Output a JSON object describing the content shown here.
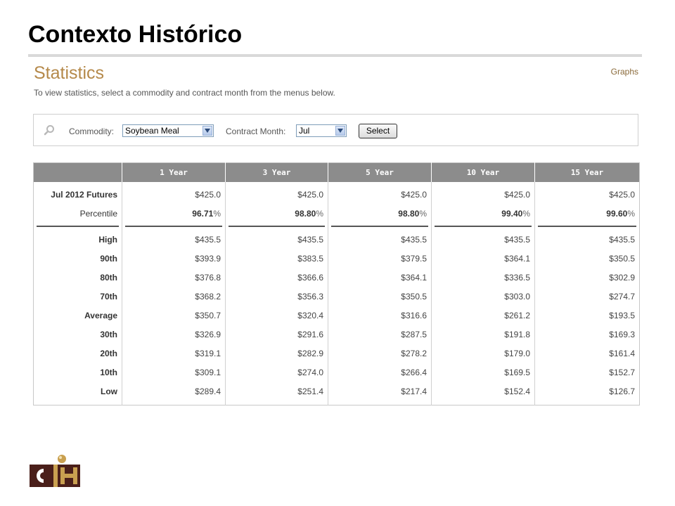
{
  "slide": {
    "title": "Contexto Histórico"
  },
  "page": {
    "heading": "Statistics",
    "graphs_link": "Graphs",
    "instructions": "To view statistics, select a commodity and contract month from the menus below."
  },
  "filters": {
    "commodity_label": "Commodity:",
    "commodity_value": "Soybean Meal",
    "month_label": "Contract Month:",
    "month_value": "Jul",
    "select_button": "Select"
  },
  "table": {
    "columns": [
      "1 Year",
      "3 Year",
      "5 Year",
      "10 Year",
      "15 Year"
    ],
    "futures": {
      "label": "Jul 2012 Futures",
      "values": [
        "$425.0",
        "$425.0",
        "$425.0",
        "$425.0",
        "$425.0"
      ]
    },
    "percentile": {
      "label": "Percentile",
      "values": [
        "96.71",
        "98.80",
        "98.80",
        "99.40",
        "99.60"
      ],
      "unit": "%"
    },
    "rows": [
      {
        "label": "High",
        "values": [
          "$435.5",
          "$435.5",
          "$435.5",
          "$435.5",
          "$435.5"
        ]
      },
      {
        "label": "90th",
        "values": [
          "$393.9",
          "$383.5",
          "$379.5",
          "$364.1",
          "$350.5"
        ]
      },
      {
        "label": "80th",
        "values": [
          "$376.8",
          "$366.6",
          "$364.1",
          "$336.5",
          "$302.9"
        ]
      },
      {
        "label": "70th",
        "values": [
          "$368.2",
          "$356.3",
          "$350.5",
          "$303.0",
          "$274.7"
        ]
      },
      {
        "label": "Average",
        "values": [
          "$350.7",
          "$320.4",
          "$316.6",
          "$261.2",
          "$193.5"
        ]
      },
      {
        "label": "30th",
        "values": [
          "$326.9",
          "$291.6",
          "$287.5",
          "$191.8",
          "$169.3"
        ]
      },
      {
        "label": "20th",
        "values": [
          "$319.1",
          "$282.9",
          "$278.2",
          "$179.0",
          "$161.4"
        ]
      },
      {
        "label": "10th",
        "values": [
          "$309.1",
          "$274.0",
          "$266.4",
          "$169.5",
          "$152.7"
        ]
      },
      {
        "label": "Low",
        "values": [
          "$289.4",
          "$251.4",
          "$217.4",
          "$152.4",
          "$126.7"
        ]
      }
    ]
  },
  "logo": {
    "text": "CIH"
  },
  "colors": {
    "heading": "#b5894a",
    "header_bg": "#8c8c8c",
    "logo_dark": "#4a1f1a",
    "logo_gold": "#c9a050"
  }
}
